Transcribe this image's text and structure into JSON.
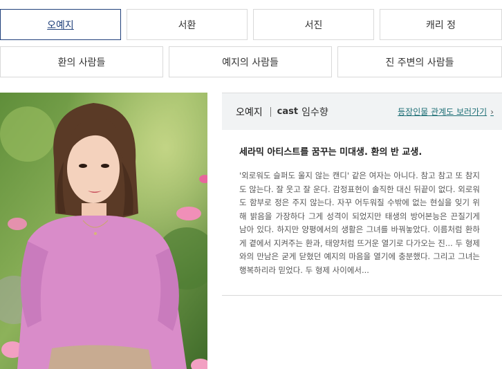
{
  "tabs_row1": [
    {
      "label": "오예지",
      "active": true
    },
    {
      "label": "서환",
      "active": false
    },
    {
      "label": "서진",
      "active": false
    },
    {
      "label": "캐리 정",
      "active": false
    }
  ],
  "tabs_row2": [
    {
      "label": "환의 사람들"
    },
    {
      "label": "예지의 사람들"
    },
    {
      "label": "진 주변의 사람들"
    }
  ],
  "profile": {
    "name": "오예지",
    "cast_label": "cast",
    "cast_name": "임수향",
    "relation_link": "등장인물 관계도 보러가기",
    "headline": "세라믹 아티스트를 꿈꾸는 미대생. 환의 반 교생.",
    "description": "'외로워도 슬퍼도 울지 않는 캔디' 같은 여자는 아니다. 참고 참고 또 참지도 않는다. 잘 웃고 잘 운다. 감정표현이 솔직한 대신 뒤끝이 없다. 외로워도 함부로 정은 주지 않는다. 자꾸 어두워질 수밖에 없는 현실을 잊기 위해 밝음을 가장하다 그게 성격이 되었지만 태생의 방어본능은 끈질기게 남아 있다. 하지만 양평에서의 생활은 그녀를 바꿔놓았다. 이름처럼 환하게 곁에서 지켜주는 환과, 태양처럼 뜨거운 열기로 다가오는 진... 두 형제와의 만남은 굳게 닫혔던 예지의 마음을 열기에 충분했다. 그리고 그녀는 행복하리라 믿었다. 두 형제 사이에서..."
  },
  "colors": {
    "active_tab": "#1f3f7a",
    "link": "#1e6f76",
    "header_bg": "#f1f3f4",
    "sweater": "#d98cc9"
  }
}
